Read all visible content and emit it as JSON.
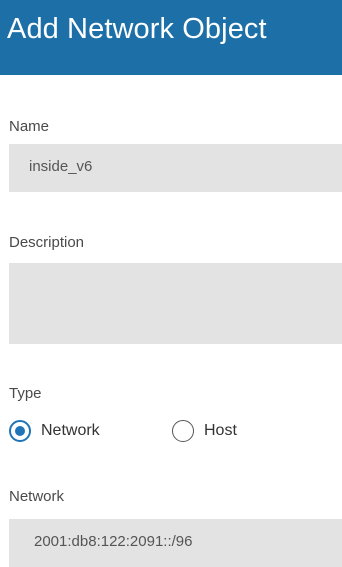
{
  "dialog": {
    "title": "Add Network Object"
  },
  "name": {
    "label": "Name",
    "value": "inside_v6"
  },
  "description": {
    "label": "Description",
    "value": ""
  },
  "type": {
    "label": "Type",
    "options": [
      {
        "label": "Network",
        "selected": true
      },
      {
        "label": "Host",
        "selected": false
      }
    ]
  },
  "network": {
    "label": "Network",
    "value": "2001:db8:122:2091::/96"
  },
  "colors": {
    "header_bg": "#1d6fa8",
    "accent": "#1f75b8",
    "field_bg": "#e3e3e3"
  }
}
